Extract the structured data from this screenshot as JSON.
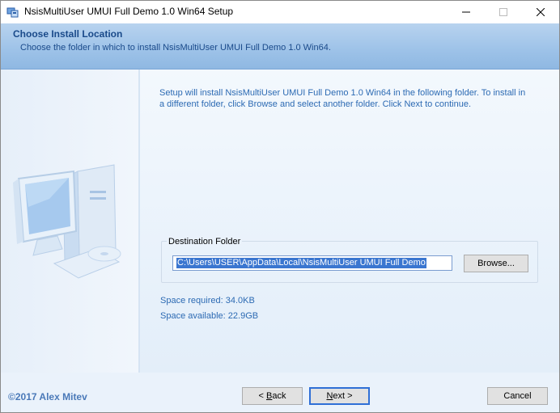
{
  "window": {
    "title": "NsisMultiUser UMUI Full Demo 1.0 Win64 Setup",
    "controls": {
      "minimize": "minimize",
      "maximize": "maximize",
      "close": "close"
    }
  },
  "header": {
    "title": "Choose Install Location",
    "subtitle": "Choose the folder in which to install NsisMultiUser UMUI Full Demo 1.0 Win64."
  },
  "main": {
    "intro": "Setup will install NsisMultiUser UMUI Full Demo 1.0 Win64 in the following folder. To install in a different folder, click Browse and select another folder. Click Next to continue.",
    "destination": {
      "group_label": "Destination Folder",
      "path": "C:\\Users\\USER\\AppData\\Local\\NsisMultiUser UMUI Full Demo",
      "browse_label": "Browse..."
    },
    "space_required": "Space required: 34.0KB",
    "space_available": "Space available: 22.9GB"
  },
  "footer": {
    "branding": "©2017 Alex Mitev",
    "back_label_u": "B",
    "back_label_pre": "< ",
    "back_label_post": "ack",
    "next_label_u": "N",
    "next_label_post": "ext >",
    "cancel_label": "Cancel"
  },
  "colors": {
    "accent": "#2c6ab3",
    "header_bg": "#9dc2e8",
    "body_bg": "#eaf2fb"
  },
  "icons": [
    "installer-icon",
    "computer-illustration"
  ]
}
